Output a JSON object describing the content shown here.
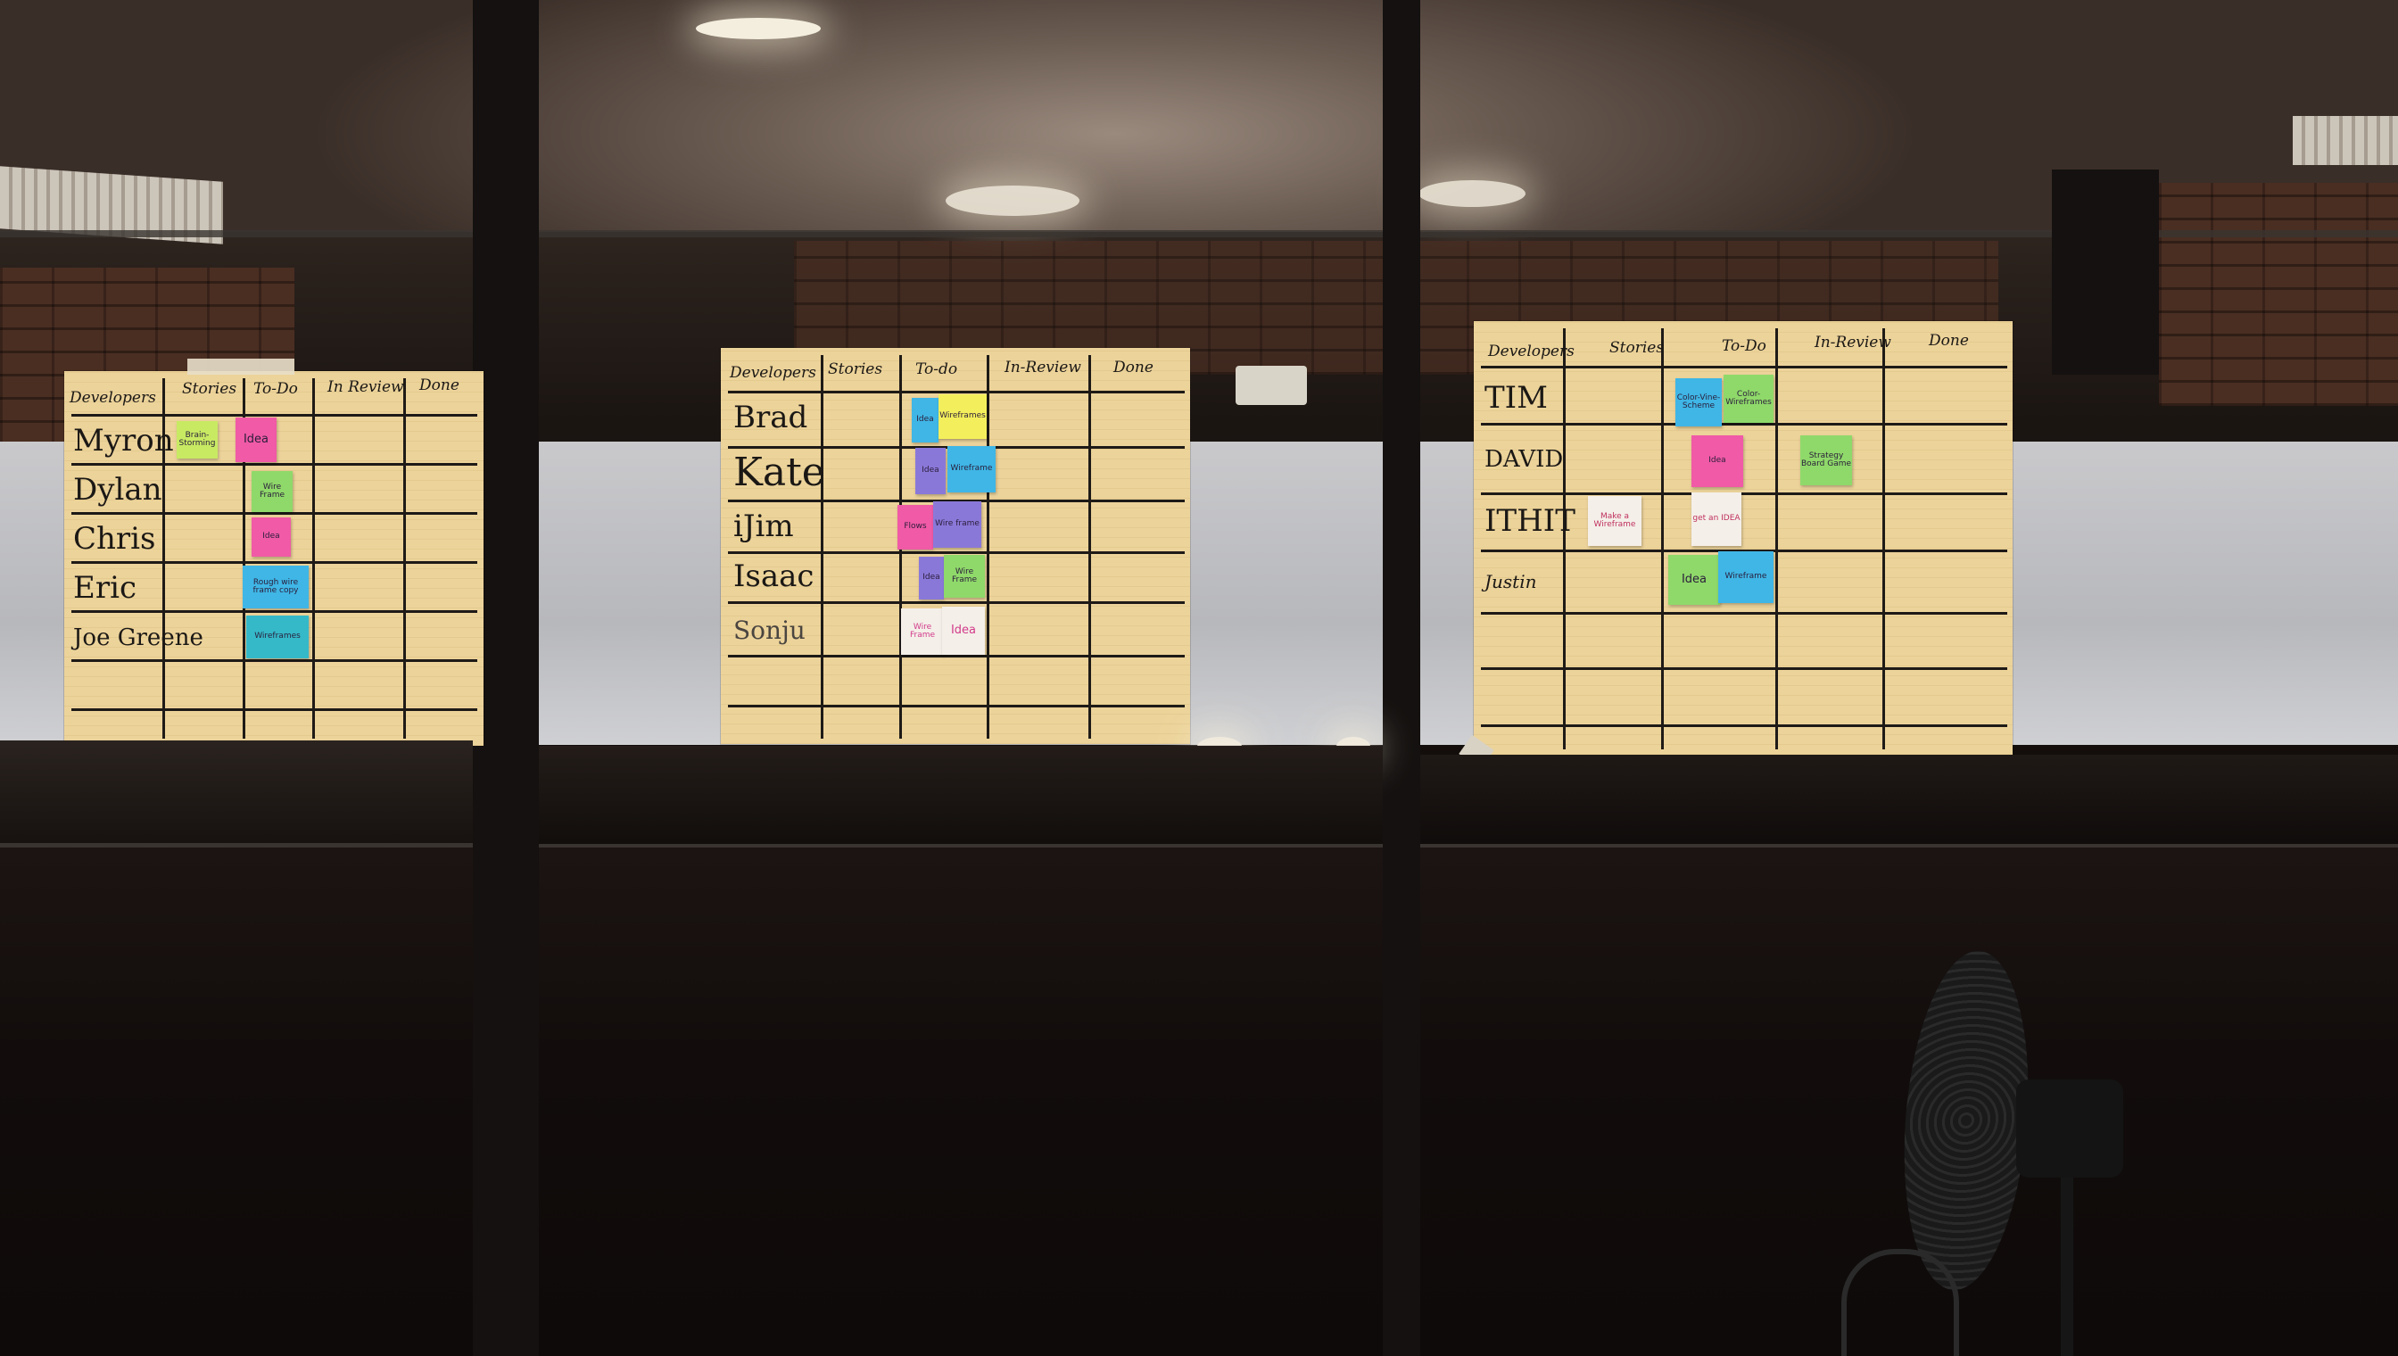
{
  "colors": {
    "poster": "#ecd39a",
    "note_yellow": "#f3ef5c",
    "note_pink": "#f05aa6",
    "note_green": "#8fd96a",
    "note_blue": "#3fb6e6",
    "note_purple": "#8a78d9",
    "note_white": "#f4efe9",
    "note_lime": "#c8ea63",
    "note_teal": "#35b9c9"
  },
  "boards": [
    {
      "headers": [
        "Developers",
        "Stories",
        "To-Do",
        "In Review",
        "Done"
      ],
      "rows": [
        "Myron",
        "Dylan",
        "Chris",
        "Eric",
        "Joe Greene"
      ],
      "notes": [
        {
          "text": "Brain-Storming"
        },
        {
          "text": "Idea"
        },
        {
          "text": "Wire Frame"
        },
        {
          "text": "Idea"
        },
        {
          "text": "Rough wire frame copy"
        },
        {
          "text": "Wireframes"
        }
      ]
    },
    {
      "headers": [
        "Developers",
        "Stories",
        "To-do",
        "In-Review",
        "Done"
      ],
      "rows": [
        "Brad",
        "Kate",
        "iJim",
        "Isaac",
        "Sonju"
      ],
      "notes": [
        {
          "text": "Idea"
        },
        {
          "text": "Wireframes"
        },
        {
          "text": "Idea"
        },
        {
          "text": "Wireframe"
        },
        {
          "text": "Flows"
        },
        {
          "text": "Wire frame"
        },
        {
          "text": "Idea"
        },
        {
          "text": "Wire Frame"
        },
        {
          "text": "Wire Frame"
        },
        {
          "text": "Idea"
        }
      ]
    },
    {
      "headers": [
        "Developers",
        "Stories",
        "To-Do",
        "In-Review",
        "Done"
      ],
      "rows": [
        "TIM",
        "DAVID",
        "ITHIT",
        "Justin"
      ],
      "notes": [
        {
          "text": "Color-Vine-Scheme"
        },
        {
          "text": "Color-Wireframes"
        },
        {
          "text": "Idea"
        },
        {
          "text": "Strategy Board Game"
        },
        {
          "text": "Make a Wireframe"
        },
        {
          "text": "get an IDEA"
        },
        {
          "text": "Idea"
        },
        {
          "text": "Wireframe"
        }
      ]
    }
  ]
}
